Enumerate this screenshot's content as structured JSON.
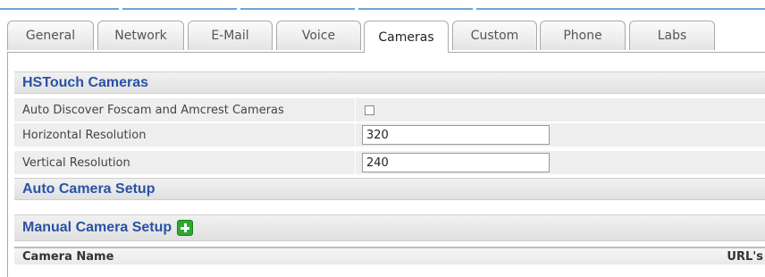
{
  "tabs": [
    {
      "label": "General",
      "active": false
    },
    {
      "label": "Network",
      "active": false
    },
    {
      "label": "E-Mail",
      "active": false
    },
    {
      "label": "Voice",
      "active": false
    },
    {
      "label": "Cameras",
      "active": true
    },
    {
      "label": "Custom",
      "active": false
    },
    {
      "label": "Phone",
      "active": false
    },
    {
      "label": "Labs",
      "active": false
    }
  ],
  "sections": {
    "hstouch": "HSTouch Cameras",
    "auto_setup": "Auto Camera Setup",
    "manual_setup": "Manual Camera Setup"
  },
  "settings": {
    "auto_discover_label": "Auto Discover Foscam and Amcrest Cameras",
    "auto_discover_checked": false,
    "horizontal_label": "Horizontal Resolution",
    "horizontal_value": "320",
    "vertical_label": "Vertical Resolution",
    "vertical_value": "240"
  },
  "table": {
    "col_camera_name": "Camera Name",
    "col_urls": "URL's"
  },
  "colors": {
    "section_title": "#2a52a4",
    "add_icon": "#2fa82f",
    "top_stripe": "#6aa6d8"
  },
  "icons": {
    "add_camera": "plus-icon"
  }
}
